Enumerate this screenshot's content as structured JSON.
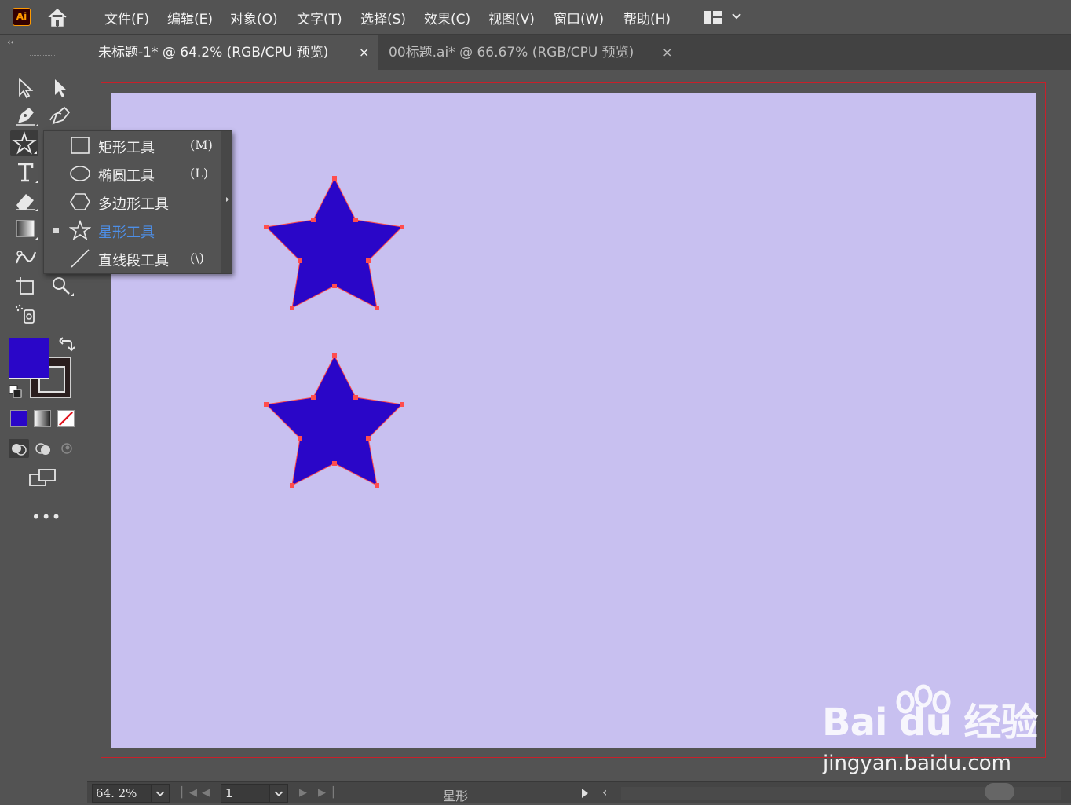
{
  "app": {
    "logo": "Ai"
  },
  "menu": [
    "文件(F)",
    "编辑(E)",
    "对象(O)",
    "文字(T)",
    "选择(S)",
    "效果(C)",
    "视图(V)",
    "窗口(W)",
    "帮助(H)"
  ],
  "tabs": [
    {
      "label": "未标题-1* @ 64.2% (RGB/CPU 预览)",
      "active": true
    },
    {
      "label": "00标题.ai* @ 66.67% (RGB/CPU 预览)",
      "active": false
    }
  ],
  "tab_close_glyph": "×",
  "toolbar": {
    "collapse_glyph": "‹‹",
    "fill_color": "#2a06c8",
    "stroke_color": "#2a1e1e",
    "more_glyph": "•••"
  },
  "flyout": {
    "items": [
      {
        "label": "矩形工具",
        "shortcut": "(M)",
        "icon": "rectangle-icon",
        "selected": false
      },
      {
        "label": "椭圆工具",
        "shortcut": "(L)",
        "icon": "ellipse-icon",
        "selected": false
      },
      {
        "label": "多边形工具",
        "shortcut": "",
        "icon": "polygon-icon",
        "selected": false
      },
      {
        "label": "星形工具",
        "shortcut": "",
        "icon": "star-icon",
        "selected": true
      },
      {
        "label": "直线段工具",
        "shortcut": "(\\)",
        "icon": "line-segment-icon",
        "selected": false
      }
    ]
  },
  "artboard": {
    "background": "#c8c0f0",
    "bleed_color": "#c8202a",
    "shape_fill": "#2a06c8",
    "anchor_color": "#ff4d4d"
  },
  "statusbar": {
    "zoom": "64. 2%",
    "page": "1",
    "status": "星形"
  },
  "watermark": {
    "logo": "Bai du 经验",
    "url": "jingyan.baidu.com"
  }
}
